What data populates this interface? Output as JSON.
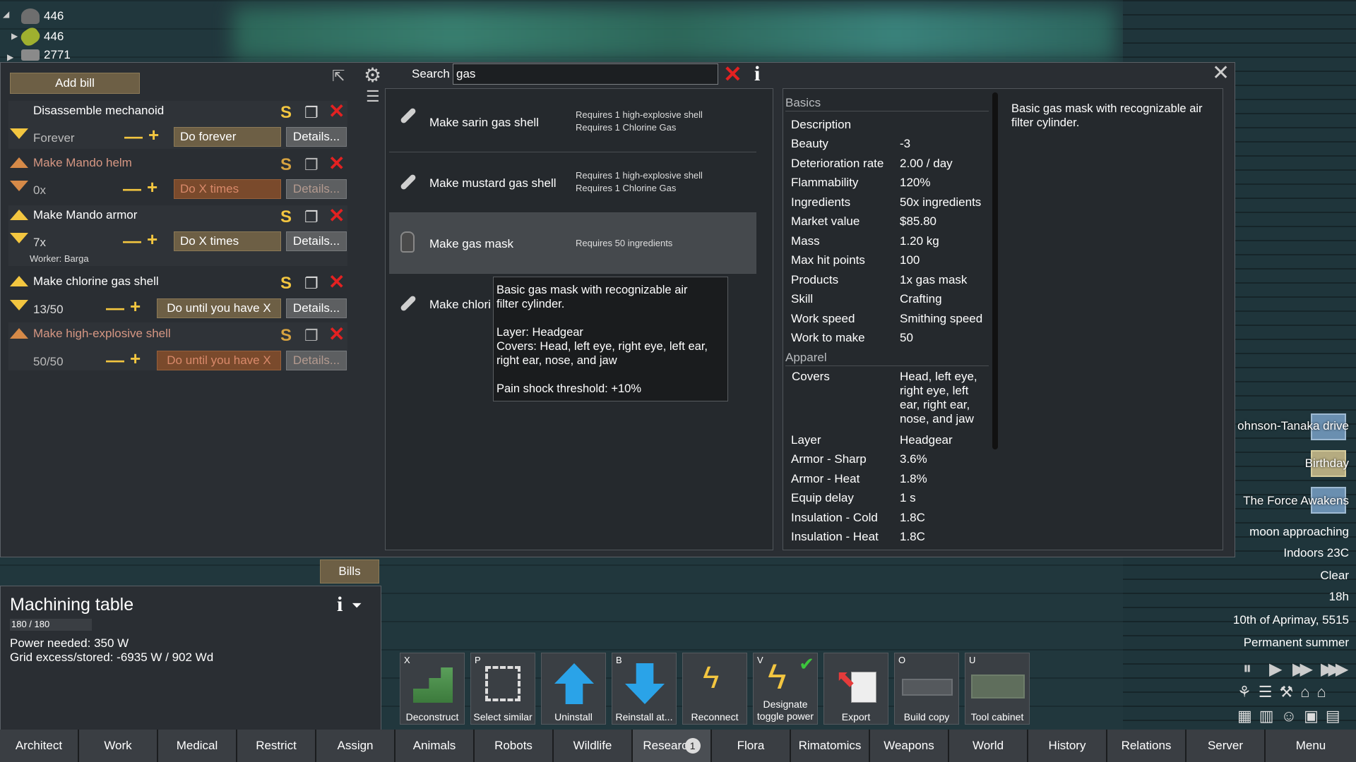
{
  "resources": [
    {
      "name": "stone-icon",
      "value": "446",
      "color": "#6e6e6e"
    },
    {
      "name": "pill-icon",
      "value": "446",
      "color": "#9fb02f"
    },
    {
      "name": "component-icon",
      "value": "2771",
      "color": "#8a8a8a"
    }
  ],
  "bills_panel": {
    "add_bill": "Add bill",
    "bills": [
      {
        "name": "Disassemble mechanoid",
        "count": "Forever",
        "mode": "Do forever",
        "details": "Details...",
        "enabled": true
      },
      {
        "name": "Make Mando helm",
        "count": "0x",
        "mode": "Do X times",
        "details": "Details...",
        "enabled": false
      },
      {
        "name": "Make Mando armor",
        "count": "7x",
        "mode": "Do X times",
        "details": "Details...",
        "enabled": true,
        "worker": "Worker: Barga"
      },
      {
        "name": "Make chlorine gas shell",
        "count": "13/50",
        "mode": "Do until you have X",
        "details": "Details...",
        "enabled": true
      },
      {
        "name": "Make high-explosive shell",
        "count": "50/50",
        "mode": "Do until you have X",
        "details": "Details...",
        "enabled": false
      }
    ]
  },
  "search": {
    "label": "Search",
    "value": "gas"
  },
  "recipes": [
    {
      "name": "Make sarin gas shell",
      "req1": "Requires 1 high-explosive shell",
      "req2": "Requires 1 Chlorine Gas"
    },
    {
      "name": "Make mustard gas shell",
      "req1": "Requires 1 high-explosive shell",
      "req2": "Requires 1 Chlorine Gas"
    },
    {
      "name": "Make gas mask",
      "req1": "Requires 50 ingredients",
      "req2": ""
    },
    {
      "name": "Make chlori",
      "req1": "",
      "req2": ""
    }
  ],
  "tooltip": {
    "line1": "Basic gas mask with recognizable air",
    "line2": "filter cylinder.",
    "line3": "Layer: Headgear",
    "line4": "Covers: Head, left eye, right eye, left ear,",
    "line5": "right ear, nose, and jaw",
    "line6": "Pain shock threshold: +10%"
  },
  "info": {
    "basics_header": "Basics",
    "apparel_header": "Apparel",
    "description_text": "Basic gas mask with recognizable air filter cylinder.",
    "basics": [
      {
        "k": "Description",
        "v": ""
      },
      {
        "k": "Beauty",
        "v": "-3"
      },
      {
        "k": "Deterioration rate",
        "v": "2.00 / day"
      },
      {
        "k": "Flammability",
        "v": "120%"
      },
      {
        "k": "Ingredients",
        "v": "50x ingredients"
      },
      {
        "k": "Market value",
        "v": "$85.80"
      },
      {
        "k": "Mass",
        "v": "1.20 kg"
      },
      {
        "k": "Max hit points",
        "v": "100"
      },
      {
        "k": "Products",
        "v": "1x gas mask"
      },
      {
        "k": "Skill",
        "v": "Crafting"
      },
      {
        "k": "Work speed",
        "v": "Smithing speed"
      },
      {
        "k": "Work to make",
        "v": "50"
      }
    ],
    "apparel_covers_label": "Covers",
    "apparel_covers": [
      "Head, left eye,",
      "right eye, left",
      "ear, right ear,",
      "nose, and jaw"
    ],
    "apparel": [
      {
        "k": "Layer",
        "v": "Headgear"
      },
      {
        "k": "Armor - Sharp",
        "v": "3.6%"
      },
      {
        "k": "Armor - Heat",
        "v": "1.8%"
      },
      {
        "k": "Equip delay",
        "v": "1 s"
      },
      {
        "k": "Insulation - Cold",
        "v": "1.8C"
      },
      {
        "k": "Insulation - Heat",
        "v": "1.8C"
      }
    ]
  },
  "bills_tab": "Bills",
  "inspect": {
    "title": "Machining table",
    "hp": "180 / 180",
    "line1": "Power needed: 350 W",
    "line2": "Grid excess/stored: -6935 W / 902 Wd"
  },
  "commands": [
    {
      "key": "X",
      "label": "Deconstruct",
      "icon": "deconstruct-icon"
    },
    {
      "key": "P",
      "label": "Select similar",
      "icon": "select-similar-icon"
    },
    {
      "key": "",
      "label": "Uninstall",
      "icon": "uninstall-icon"
    },
    {
      "key": "B",
      "label": "Reinstall at...",
      "icon": "reinstall-icon"
    },
    {
      "key": "",
      "label": "Reconnect",
      "icon": "reconnect-icon"
    },
    {
      "key": "V",
      "label": "Designate toggle power",
      "label1": "Designate",
      "label2": "toggle power",
      "icon": "toggle-power-icon"
    },
    {
      "key": "",
      "label": "Export",
      "icon": "export-icon"
    },
    {
      "key": "O",
      "label": "Build copy",
      "icon": "build-copy-icon"
    },
    {
      "key": "U",
      "label": "Tool cabinet",
      "icon": "tool-cabinet-icon"
    }
  ],
  "tabs": [
    "Architect",
    "Work",
    "Medical",
    "Restrict",
    "Assign",
    "Animals",
    "Robots",
    "Wildlife",
    "Researc",
    "Flora",
    "Rimatomics",
    "Weapons",
    "World",
    "History",
    "Relations",
    "Server",
    "Menu"
  ],
  "research_badge": "1",
  "right_panel": {
    "event1": "ohnson-Tanaka drive",
    "event2": "Birthday",
    "event3": "The Force Awakens",
    "moon": "moon approaching",
    "temp": "Indoors 23C",
    "weather": "Clear",
    "hour": "18h",
    "date": "10th of Aprimay, 5515",
    "season": "Permanent summer"
  }
}
